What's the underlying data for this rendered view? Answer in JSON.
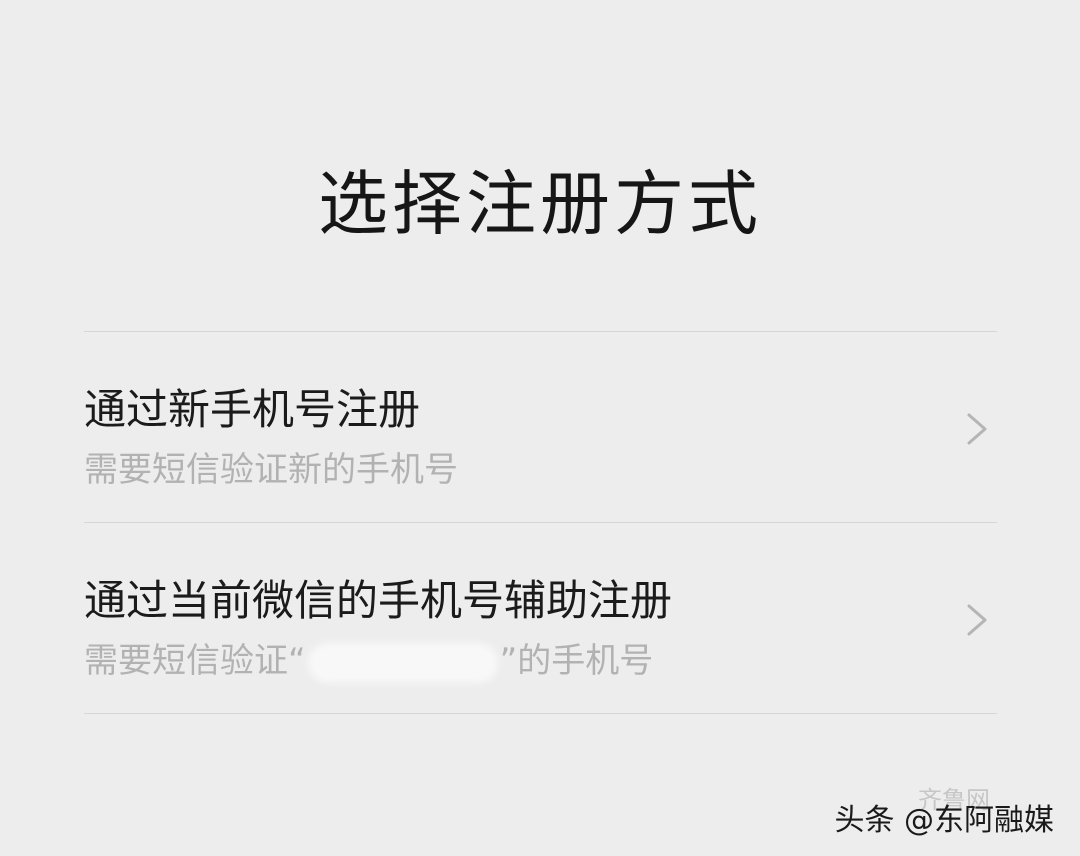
{
  "title": "选择注册方式",
  "options": [
    {
      "title": "通过新手机号注册",
      "subtitle": "需要短信验证新的手机号"
    },
    {
      "title": "通过当前微信的手机号辅助注册",
      "subtitle_prefix": "需要短信验证“",
      "subtitle_suffix": "”的手机号"
    }
  ],
  "icons": {
    "chevron": "chevron-right-icon"
  },
  "colors": {
    "background": "#ededed",
    "title": "#161616",
    "subtitle": "#b2b2b2",
    "divider": "#d6d6d6"
  },
  "watermark": {
    "text": "头条 @东阿融媒",
    "faint_text": "齐鲁网"
  }
}
